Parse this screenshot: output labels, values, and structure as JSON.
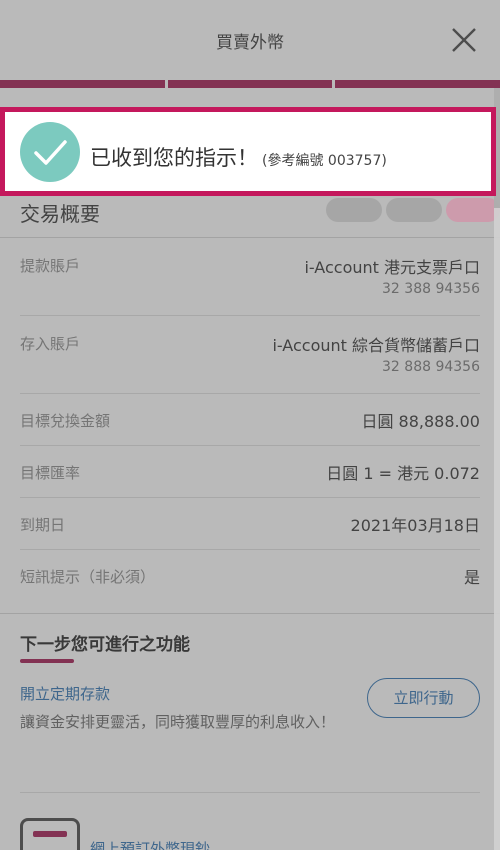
{
  "header": {
    "title": "買賣外幣"
  },
  "toast": {
    "message": "已收到您的指示！",
    "reference": "(參考編號 003757)",
    "accent_color": "#c4185c"
  },
  "summary": {
    "title": "交易概要",
    "rows": [
      {
        "label": "提款賬戶",
        "value": "i-Account 港元支票戶口",
        "sub": "32 388 94356"
      },
      {
        "label": "存入賬戶",
        "value": "i-Account 綜合貨幣儲蓄戶口",
        "sub": "32 888 94356"
      },
      {
        "label": "目標兌換金額",
        "value": "日圓 88,888.00"
      },
      {
        "label": "目標匯率",
        "value": "日圓 1 = 港元 0.072"
      },
      {
        "label": "到期日",
        "value": "2021年03月18日"
      },
      {
        "label": "短訊提示（非必須）",
        "value": "是"
      }
    ]
  },
  "next_steps": {
    "title": "下一步您可進行之功能",
    "fixed_deposit": {
      "link": "開立定期存款",
      "description": "讓資金安排更靈活，同時獲取豐厚的利息收入！",
      "action": "立即行動"
    },
    "fx_preorder": {
      "label": "網上預訂外幣現鈔"
    }
  },
  "colors": {
    "brand": "#a0154e",
    "link": "#2a6fb0",
    "success": "#7ccabf"
  },
  "icons": {
    "close": "close-icon",
    "success": "check-circle-icon",
    "fx": "fx-cash-icon"
  }
}
